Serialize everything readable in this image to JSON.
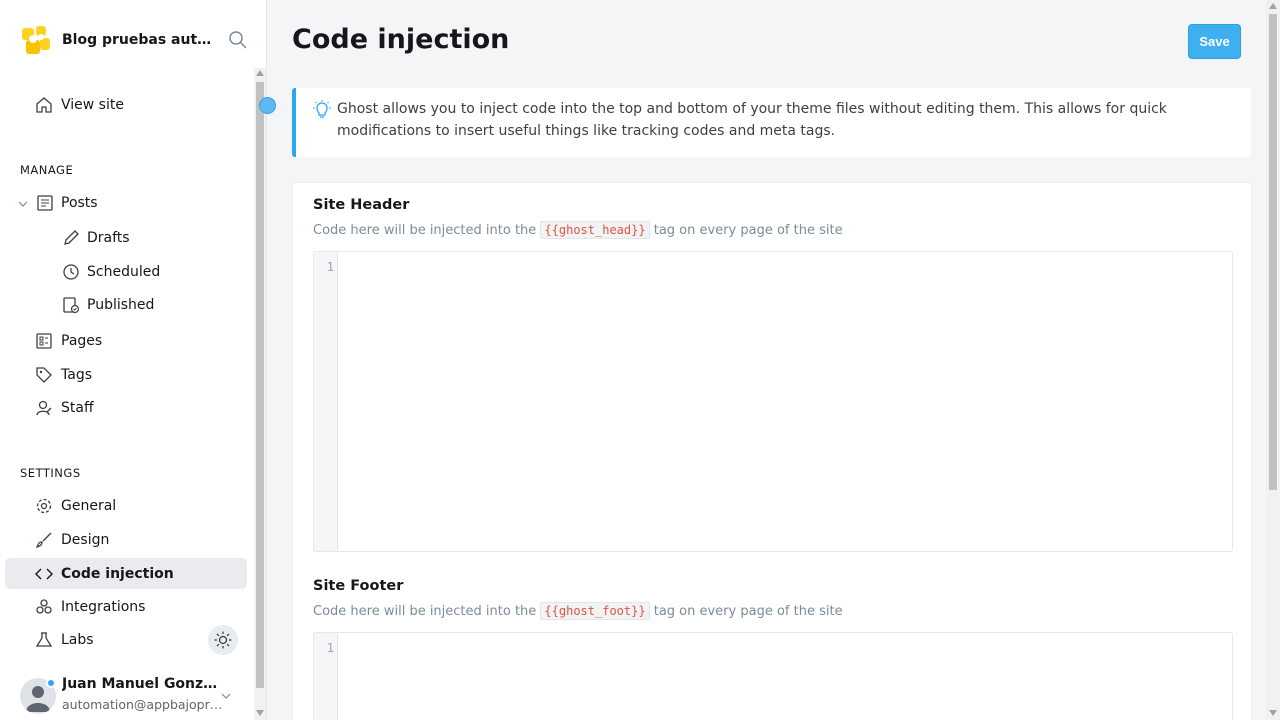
{
  "app": {
    "title": "Blog pruebas auto..."
  },
  "sidebar": {
    "view_site": "View site",
    "manage_title": "MANAGE",
    "settings_title": "SETTINGS",
    "posts": {
      "label": "Posts",
      "drafts": "Drafts",
      "scheduled": "Scheduled",
      "published": "Published"
    },
    "pages": "Pages",
    "tags": "Tags",
    "staff": "Staff",
    "general": "General",
    "design": "Design",
    "code_injection": "Code injection",
    "integrations": "Integrations",
    "labs": "Labs"
  },
  "user": {
    "name": "Juan Manuel Gonzále...",
    "email": "automation@appbajopru..."
  },
  "main": {
    "title": "Code injection",
    "save_label": "Save",
    "callout": "Ghost allows you to inject code into the top and bottom of your theme files without editing them. This allows for quick modifications to insert useful things like tracking codes and meta tags.",
    "header": {
      "title": "Site Header",
      "desc_before": "Code here will be injected into the",
      "tag": "{{ghost_head}}",
      "desc_after": "tag on every page of the site",
      "line": "1"
    },
    "footer": {
      "title": "Site Footer",
      "desc_before": "Code here will be injected into the",
      "tag": "{{ghost_foot}}",
      "desc_after": "tag on every page of the site",
      "line": "1"
    }
  },
  "colors": {
    "accent": "#3eb0ef",
    "callout_border": "#30a4f3",
    "active_nav_bg": "#e9ebee",
    "code_tag": "#e25440"
  }
}
